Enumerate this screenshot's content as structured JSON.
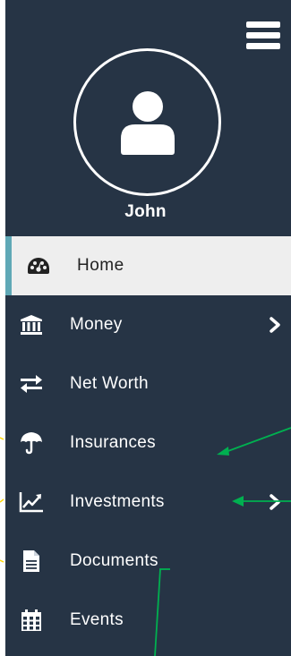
{
  "user": {
    "name": "John"
  },
  "menu": {
    "items": [
      {
        "label": "Home"
      },
      {
        "label": "Money"
      },
      {
        "label": "Net Worth"
      },
      {
        "label": "Insurances"
      },
      {
        "label": "Investments"
      },
      {
        "label": "Documents"
      },
      {
        "label": "Events"
      }
    ]
  },
  "colors": {
    "sidebar_bg": "#263445",
    "active_bg": "#eeeeee",
    "accent": "#5fa8b6",
    "annotation_green": "#00b050",
    "annotation_yellow": "#ffd700"
  },
  "icons": {
    "menu": "hamburger-icon",
    "avatar": "user-icon",
    "home": "tachometer-icon",
    "money": "bank-icon",
    "net_worth": "exchange-arrows-icon",
    "insurances": "umbrella-icon",
    "investments": "line-chart-icon",
    "documents": "document-icon",
    "events": "calendar-icon",
    "submenu": "chevron-right-icon"
  }
}
